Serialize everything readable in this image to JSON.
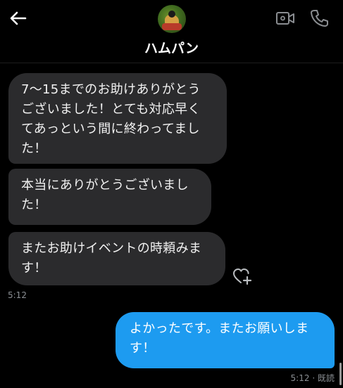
{
  "header": {
    "contact_name": "ハムパン",
    "icons": [
      "back-arrow-icon",
      "video-call-icon",
      "phone-icon"
    ],
    "accent": "#1d9bf0"
  },
  "messages": [
    {
      "sender": "other",
      "text": "7～15までのお助けありがとう\nございました！とても対応早く\nてあっという間に終わってまし\nた！"
    },
    {
      "sender": "other",
      "text": "本当にありがとうございまし\nた！"
    },
    {
      "sender": "other",
      "text": "またお助けイベントの時頼みま\nす！"
    },
    {
      "sender": "me",
      "text": "よかったです。またお願いしま\nす！"
    }
  ],
  "timestamps": {
    "received": "5:12",
    "sent": "5:12",
    "separator": "·",
    "read_status": "既読"
  }
}
